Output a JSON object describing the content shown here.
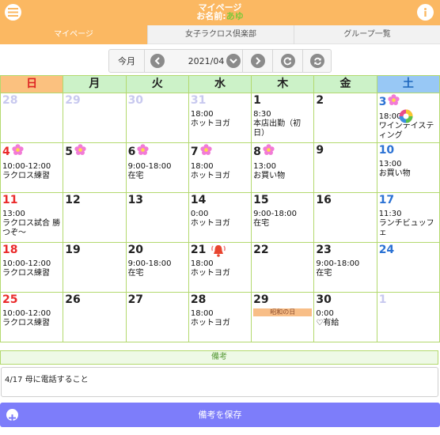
{
  "header": {
    "title": "マイページ",
    "name_label": "お名前:",
    "user_name": "あゆ"
  },
  "tabs": [
    "マイページ",
    "女子ラクロス倶楽部",
    "グループ一覧"
  ],
  "toolbar": {
    "today_label": "今月",
    "month": "2021/04"
  },
  "weekdays": [
    "日",
    "月",
    "火",
    "水",
    "木",
    "金",
    "土"
  ],
  "weeks": [
    [
      {
        "day": "28",
        "other": true
      },
      {
        "day": "29",
        "other": true
      },
      {
        "day": "30",
        "other": true
      },
      {
        "day": "31",
        "other": true,
        "events": [
          {
            "time": "18:00",
            "text": "ホットヨガ"
          }
        ]
      },
      {
        "day": "1",
        "events": [
          {
            "time": "8:30",
            "text": "本店出勤（初日）"
          }
        ]
      },
      {
        "day": "2"
      },
      {
        "day": "3",
        "flower": true,
        "events": [
          {
            "time": "18:00",
            "text": "ワインテイスティング"
          }
        ]
      }
    ],
    [
      {
        "day": "4",
        "flower": true,
        "events": [
          {
            "time": "10:00-12:00",
            "text": "ラクロス練習"
          }
        ]
      },
      {
        "day": "5",
        "flower": true
      },
      {
        "day": "6",
        "flower": true,
        "events": [
          {
            "time": "9:00-18:00",
            "text": "在宅"
          }
        ]
      },
      {
        "day": "7",
        "flower": true,
        "events": [
          {
            "time": "18:00",
            "text": "ホットヨガ"
          }
        ]
      },
      {
        "day": "8",
        "flower": true,
        "events": [
          {
            "time": "13:00",
            "text": "お買い物"
          }
        ]
      },
      {
        "day": "9"
      },
      {
        "day": "10",
        "events": [
          {
            "time": "13:00",
            "text": "お買い物"
          }
        ]
      }
    ],
    [
      {
        "day": "11",
        "events": [
          {
            "time": "13:00",
            "text": "ラクロス試合 勝つぞ〜"
          }
        ]
      },
      {
        "day": "12"
      },
      {
        "day": "13"
      },
      {
        "day": "14",
        "events": [
          {
            "time": "0:00",
            "text": "ホットヨガ"
          }
        ]
      },
      {
        "day": "15",
        "events": [
          {
            "time": "9:00-18:00",
            "text": "在宅"
          }
        ]
      },
      {
        "day": "16"
      },
      {
        "day": "17",
        "events": [
          {
            "time": "11:30",
            "text": "ランチビュッフェ"
          }
        ]
      }
    ],
    [
      {
        "day": "18",
        "events": [
          {
            "time": "10:00-12:00",
            "text": "ラクロス練習"
          }
        ]
      },
      {
        "day": "19"
      },
      {
        "day": "20",
        "events": [
          {
            "time": "9:00-18:00",
            "text": "在宅"
          }
        ]
      },
      {
        "day": "21",
        "bell": true,
        "events": [
          {
            "time": "18:00",
            "text": "ホットヨガ"
          }
        ]
      },
      {
        "day": "22"
      },
      {
        "day": "23",
        "events": [
          {
            "time": "9:00-18:00",
            "text": "在宅"
          }
        ]
      },
      {
        "day": "24"
      }
    ],
    [
      {
        "day": "25",
        "events": [
          {
            "time": "10:00-12:00",
            "text": "ラクロス練習"
          }
        ]
      },
      {
        "day": "26"
      },
      {
        "day": "27"
      },
      {
        "day": "28",
        "events": [
          {
            "time": "18:00",
            "text": "ホットヨガ"
          }
        ]
      },
      {
        "day": "29",
        "holiday": "昭和の日"
      },
      {
        "day": "30",
        "events": [
          {
            "time": "0:00",
            "text": "♡有給"
          }
        ]
      },
      {
        "day": "1",
        "other": true
      }
    ]
  ],
  "remarks": {
    "label": "備考",
    "text": "4/17 母に電話すること"
  },
  "save_button": {
    "label": "備考を保存"
  },
  "colors": {
    "header": "#fbb862",
    "sunday": "#ea2a2a",
    "saturday": "#2b72d4",
    "save": "#7d7dfa",
    "grid": "#b3d96e"
  }
}
